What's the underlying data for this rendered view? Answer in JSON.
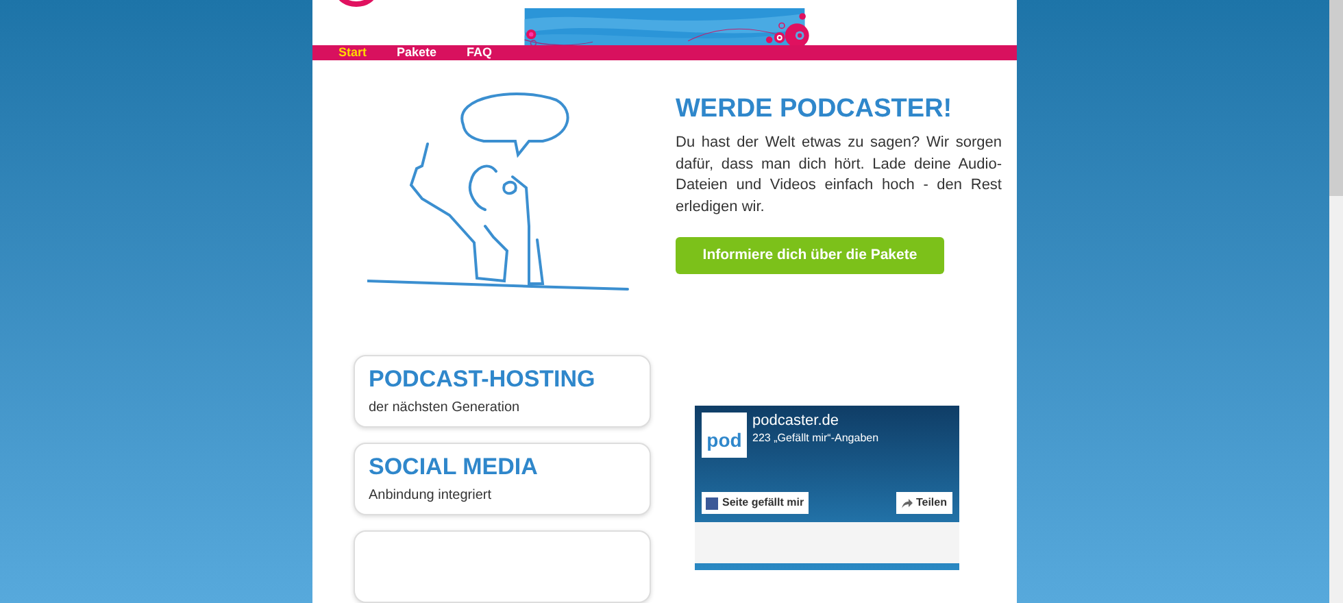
{
  "nav": [
    {
      "label": "Start",
      "selected": true
    },
    {
      "label": "Pakete",
      "selected": false
    },
    {
      "label": "FAQ",
      "selected": false
    }
  ],
  "hero": {
    "title": "WERDE PODCASTER!",
    "text": "Du hast der Welt etwas zu sagen? Wir sorgen dafür, dass man dich hört. Lade deine Audio-Dateien und Videos einfach hoch - den Rest erledigen wir.",
    "button": "Informiere dich über die Pakete"
  },
  "features": [
    {
      "title": "PODCAST-HOSTING",
      "subtitle": "der nächsten Generation"
    },
    {
      "title": "SOCIAL MEDIA",
      "subtitle": "Anbindung integriert"
    }
  ],
  "facebook": {
    "logo": "pod",
    "name": "podcaster.de",
    "likes": "223 „Gefällt mir“-Angaben",
    "like_button": "Seite gefällt mir",
    "share_button": "Teilen"
  }
}
